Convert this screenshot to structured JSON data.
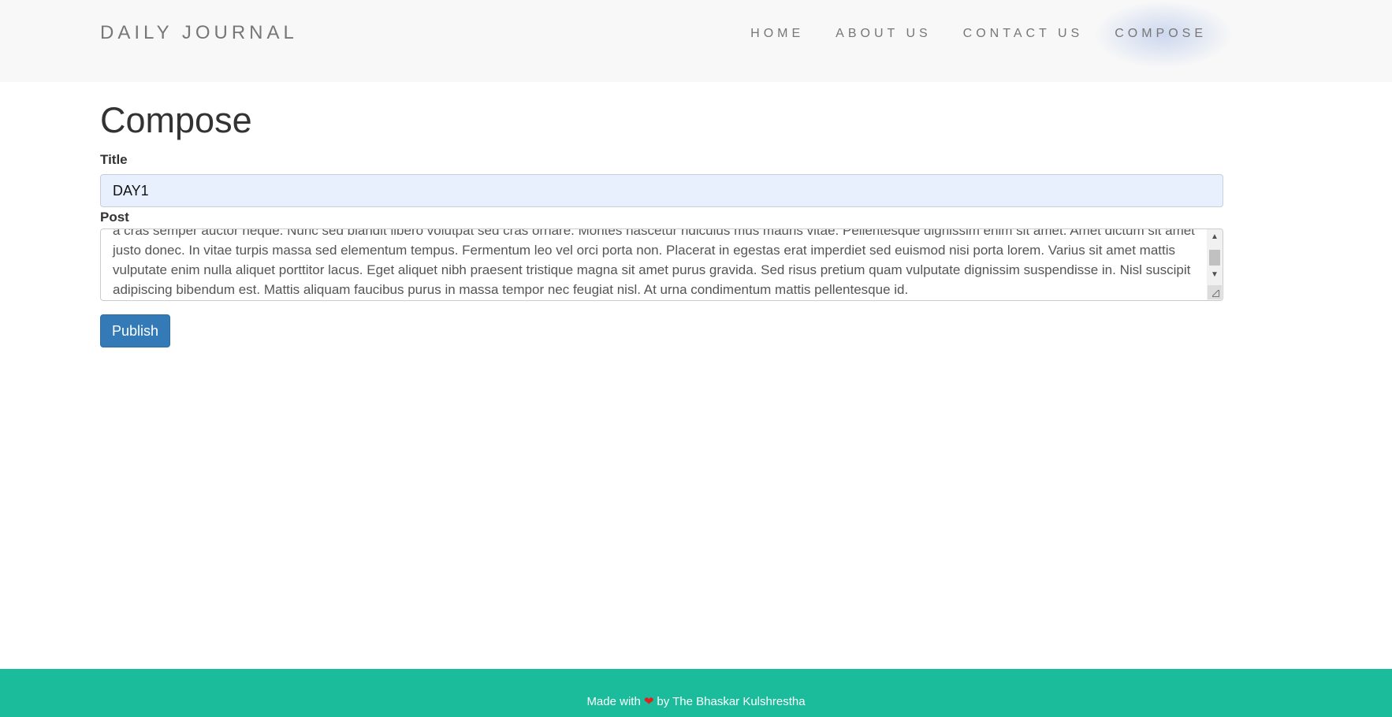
{
  "navbar": {
    "brand": "DAILY JOURNAL",
    "items": [
      {
        "label": "HOME"
      },
      {
        "label": "ABOUT US"
      },
      {
        "label": "CONTACT US"
      },
      {
        "label": "COMPOSE",
        "active": true
      }
    ]
  },
  "page": {
    "heading": "Compose"
  },
  "form": {
    "title_label": "Title",
    "title_value": "DAY1",
    "post_label": "Post",
    "post_value": "a cras semper auctor neque. Nunc sed blandit libero volutpat sed cras ornare. Montes nascetur ridiculus mus mauris vitae. Pellentesque dignissim enim sit amet. Amet dictum sit amet justo donec. In vitae turpis massa sed elementum tempus. Fermentum leo vel orci porta non. Placerat in egestas erat imperdiet sed euismod nisi porta lorem. Varius sit amet mattis vulputate enim nulla aliquet porttitor lacus. Eget aliquet nibh praesent tristique magna sit amet purus gravida. Sed risus pretium quam vulputate dignissim suspendisse in. Nisl suscipit adipiscing bibendum est. Mattis aliquam faucibus purus in massa tempor nec feugiat nisl. At urna condimentum mattis pellentesque id.",
    "publish_label": "Publish"
  },
  "footer": {
    "prefix": "Made with",
    "heart": "❤",
    "suffix": "by The Bhaskar Kulshrestha"
  },
  "colors": {
    "navbar_bg": "#f8f8f8",
    "primary_button": "#337ab7",
    "footer_bg": "#1abc9c",
    "title_input_bg": "#e8f0fe",
    "heart": "#e02020"
  }
}
